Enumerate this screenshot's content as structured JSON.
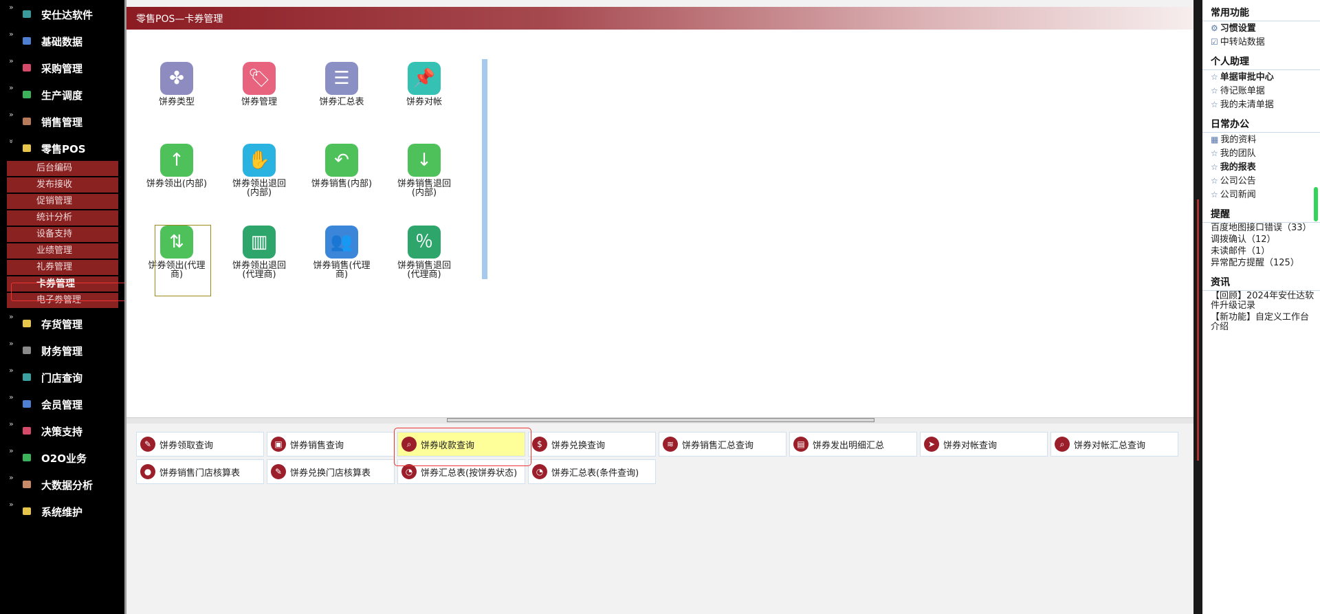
{
  "sidebar": {
    "groups": [
      {
        "label": "安仕达软件",
        "color": "#3a9a9a"
      },
      {
        "label": "基础数据",
        "color": "#4f7fd1"
      },
      {
        "label": "采购管理",
        "color": "#d54a6a"
      },
      {
        "label": "生产调度",
        "color": "#3cb35a"
      },
      {
        "label": "销售管理",
        "color": "#b77a5a"
      },
      {
        "label": "零售POS",
        "color": "#e6c64a"
      }
    ],
    "sub_items": [
      {
        "label": "后台编码"
      },
      {
        "label": "发布接收"
      },
      {
        "label": "促销管理"
      },
      {
        "label": "统计分析"
      },
      {
        "label": "设备支持"
      },
      {
        "label": "业绩管理"
      },
      {
        "label": "礼券管理"
      },
      {
        "label": "卡券管理",
        "active": true
      },
      {
        "label": "电子劵管理"
      }
    ],
    "groups_after": [
      {
        "label": "存货管理",
        "color": "#e6c64a"
      },
      {
        "label": "财务管理",
        "color": "#8a8a8a"
      },
      {
        "label": "门店查询",
        "color": "#3aa0a0"
      },
      {
        "label": "会员管理",
        "color": "#4f7fd1"
      },
      {
        "label": "决策支持",
        "color": "#d54a6a"
      },
      {
        "label": "O2O业务",
        "color": "#3cb35a"
      },
      {
        "label": "大数据分析",
        "color": "#c98a6a"
      },
      {
        "label": "系统维护",
        "color": "#e6c64a"
      }
    ]
  },
  "main": {
    "title": "零售POS—卡券管理",
    "tiles": [
      {
        "label": "饼券类型",
        "color": "#8e8bc1",
        "glyph": "✤"
      },
      {
        "label": "饼券管理",
        "color": "#e8637e",
        "glyph": "🏷"
      },
      {
        "label": "饼券汇总表",
        "color": "#8a8fc4",
        "glyph": "☰"
      },
      {
        "label": "饼券对帐",
        "color": "#35c2b4",
        "glyph": "📌"
      },
      {
        "label": "饼券领出(内部)",
        "color": "#4fc15a",
        "glyph": "↑"
      },
      {
        "label": "饼券领出退回(内部)",
        "color": "#2ab2e0",
        "glyph": "✋"
      },
      {
        "label": "饼券销售(内部)",
        "color": "#4fc15a",
        "glyph": "↶"
      },
      {
        "label": "饼券销售退回(内部)",
        "color": "#4fc15a",
        "glyph": "↓"
      },
      {
        "label": "饼券领出(代理商)",
        "color": "#4fc15a",
        "glyph": "⇅"
      },
      {
        "label": "饼券领出退回(代理商)",
        "color": "#2ea56a",
        "glyph": "▥"
      },
      {
        "label": "饼券销售(代理商)",
        "color": "#3b86d9",
        "glyph": "👥"
      },
      {
        "label": "饼券销售退回(代理商)",
        "color": "#2ea56a",
        "glyph": "％"
      }
    ],
    "links": [
      {
        "label": "饼券领取查询",
        "glyph": "✎"
      },
      {
        "label": "饼券销售查询",
        "glyph": "▣"
      },
      {
        "label": "饼券收款查询",
        "glyph": "⌕",
        "highlight": true
      },
      {
        "label": "饼券兑换查询",
        "glyph": "$"
      },
      {
        "label": "饼券销售汇总查询",
        "glyph": "≋"
      },
      {
        "label": "饼券发出明细汇总",
        "glyph": "▤"
      },
      {
        "label": "饼券对帐查询",
        "glyph": "➤"
      },
      {
        "label": "饼券对帐汇总查询",
        "glyph": "⌕"
      },
      {
        "label": "饼券销售门店核算表",
        "glyph": "●"
      },
      {
        "label": "饼券兑换门店核算表",
        "glyph": "✎"
      },
      {
        "label": "饼券汇总表(按饼券状态)",
        "glyph": "◔"
      },
      {
        "label": "饼券汇总表(条件查询)",
        "glyph": "◔"
      }
    ]
  },
  "right_panel": {
    "common": {
      "title": "常用功能",
      "items": [
        {
          "label": "习惯设置",
          "bold": true,
          "glyph": "⚙"
        },
        {
          "label": "中转站数据",
          "bold": false,
          "glyph": "☑"
        }
      ]
    },
    "assistant": {
      "title": "个人助理",
      "items": [
        {
          "label": "单据审批中心",
          "bold": true
        },
        {
          "label": "待记账单据",
          "bold": false
        },
        {
          "label": "我的未清单据",
          "bold": false
        }
      ]
    },
    "office": {
      "title": "日常办公",
      "items": [
        {
          "label": "我的资料",
          "bold": false,
          "glyph": "▦"
        },
        {
          "label": "我的团队",
          "bold": false,
          "glyph": "☆"
        },
        {
          "label": "我的报表",
          "bold": true,
          "glyph": "☆"
        },
        {
          "label": "公司公告",
          "bold": false,
          "glyph": "☆"
        },
        {
          "label": "公司新闻",
          "bold": false,
          "glyph": "☆"
        }
      ]
    },
    "reminders": {
      "title": "提醒",
      "items": [
        "百度地图接口错误（33）",
        "调拨确认（12）",
        "未读邮件（1）",
        "异常配方提醒（125）"
      ]
    },
    "news": {
      "title": "资讯",
      "items": [
        "【回顾】2024年安仕达软件升级记录",
        "【新功能】自定义工作台介绍"
      ]
    }
  }
}
